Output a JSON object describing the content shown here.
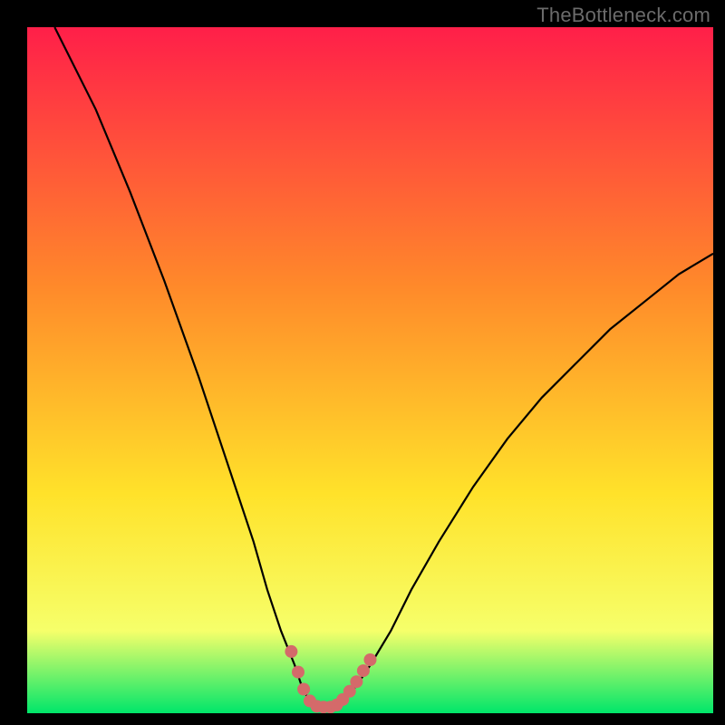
{
  "watermark": "TheBottleneck.com",
  "colors": {
    "frame": "#000000",
    "gradient_top": "#ff1f49",
    "gradient_mid1": "#ff8a2a",
    "gradient_mid2": "#ffe22a",
    "gradient_mid3": "#f6ff6a",
    "gradient_bottom": "#00e66a",
    "curve": "#000000",
    "dots": "#d46a6a"
  },
  "chart_data": {
    "type": "line",
    "title": "",
    "xlabel": "",
    "ylabel": "",
    "xlim": [
      0,
      100
    ],
    "ylim": [
      0,
      100
    ],
    "x": [
      4,
      10,
      15,
      20,
      25,
      30,
      33,
      35,
      37,
      39,
      40,
      41,
      42,
      43,
      44,
      45,
      46,
      48,
      50,
      53,
      56,
      60,
      65,
      70,
      75,
      80,
      85,
      90,
      95,
      100
    ],
    "values": [
      100,
      88,
      76,
      63,
      49,
      34,
      25,
      18,
      12,
      7,
      4,
      2,
      1,
      1,
      1,
      1,
      2,
      4,
      7,
      12,
      18,
      25,
      33,
      40,
      46,
      51,
      56,
      60,
      64,
      67
    ],
    "series": [
      {
        "name": "bottleneck-curve",
        "x": [
          4,
          10,
          15,
          20,
          25,
          30,
          33,
          35,
          37,
          39,
          40,
          41,
          42,
          43,
          44,
          45,
          46,
          48,
          50,
          53,
          56,
          60,
          65,
          70,
          75,
          80,
          85,
          90,
          95,
          100
        ],
        "y": [
          100,
          88,
          76,
          63,
          49,
          34,
          25,
          18,
          12,
          7,
          4,
          2,
          1,
          1,
          1,
          1,
          2,
          4,
          7,
          12,
          18,
          25,
          33,
          40,
          46,
          51,
          56,
          60,
          64,
          67
        ]
      }
    ],
    "dots": [
      {
        "x": 38.5,
        "y": 9
      },
      {
        "x": 39.5,
        "y": 6
      },
      {
        "x": 40.3,
        "y": 3.5
      },
      {
        "x": 41.2,
        "y": 1.8
      },
      {
        "x": 42.2,
        "y": 1.0
      },
      {
        "x": 43.2,
        "y": 0.9
      },
      {
        "x": 44.2,
        "y": 0.9
      },
      {
        "x": 45.1,
        "y": 1.2
      },
      {
        "x": 46.0,
        "y": 2.0
      },
      {
        "x": 47.0,
        "y": 3.2
      },
      {
        "x": 48.0,
        "y": 4.6
      },
      {
        "x": 49.0,
        "y": 6.2
      },
      {
        "x": 50.0,
        "y": 7.8
      }
    ]
  }
}
